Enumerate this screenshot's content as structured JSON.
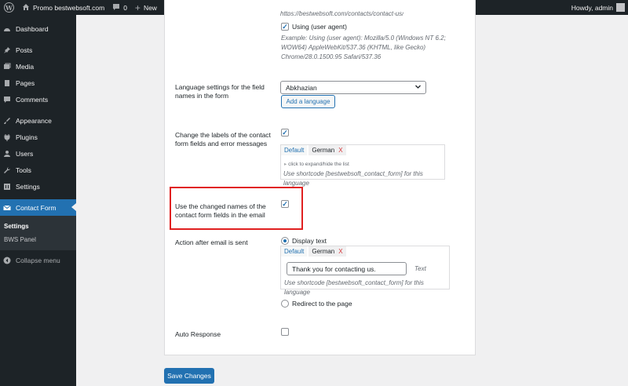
{
  "adminbar": {
    "site_name": "Promo bestwebsoft.com",
    "comments_count": "0",
    "new_label": "New",
    "howdy": "Howdy, admin"
  },
  "sidebar": {
    "items": [
      {
        "label": "Dashboard",
        "icon": "dashboard-icon"
      },
      {
        "label": "Posts",
        "icon": "pin-icon"
      },
      {
        "label": "Media",
        "icon": "media-icon"
      },
      {
        "label": "Pages",
        "icon": "pages-icon"
      },
      {
        "label": "Comments",
        "icon": "comment-icon"
      },
      {
        "label": "Appearance",
        "icon": "brush-icon"
      },
      {
        "label": "Plugins",
        "icon": "plug-icon"
      },
      {
        "label": "Users",
        "icon": "user-icon"
      },
      {
        "label": "Tools",
        "icon": "wrench-icon"
      },
      {
        "label": "Settings",
        "icon": "settings-icon"
      },
      {
        "label": "Contact Form",
        "icon": "envelope-icon"
      }
    ],
    "submenu": [
      "Settings",
      "BWS Panel"
    ],
    "collapse_label": "Collapse menu"
  },
  "form": {
    "top_url": "https://bestwebsoft.com/contacts/contact-us/",
    "user_agent_label": "Using (user agent)",
    "user_agent_checked": true,
    "user_agent_example": "Example: Using (user agent): Mozilla/5.0 (Windows NT 6.2; WOW64) AppleWebKit/537.36 (KHTML, like Gecko) Chrome/28.0.1500.95 Safari/537.36",
    "language_label": "Language settings for the field names in the form",
    "language_value": "Abkhazian",
    "add_language_button": "Add a language",
    "change_labels_label": "Change the labels of the contact form fields and error messages",
    "change_labels_checked": true,
    "lang_tabs": [
      {
        "name": "Default"
      },
      {
        "name": "German",
        "close": "X"
      }
    ],
    "expand_hint": "click to expand/hide the list",
    "shortcode_hint": "Use shortcode [bestwebsoft_contact_form] for this language",
    "changed_names_label": "Use the changed names of the contact form fields in the email",
    "changed_names_checked": true,
    "action_label": "Action after email is sent",
    "display_text_label": "Display text",
    "display_text_selected": true,
    "thank_you_value": "Thank you for contacting us.",
    "text_hint": "Text",
    "redirect_label": "Redirect to the page",
    "auto_response_label": "Auto Response",
    "auto_response_checked": false,
    "save_button": "Save Changes"
  },
  "colors": {
    "accent": "#2271b1",
    "sidebar": "#1d2327",
    "highlight": "#e02020"
  }
}
